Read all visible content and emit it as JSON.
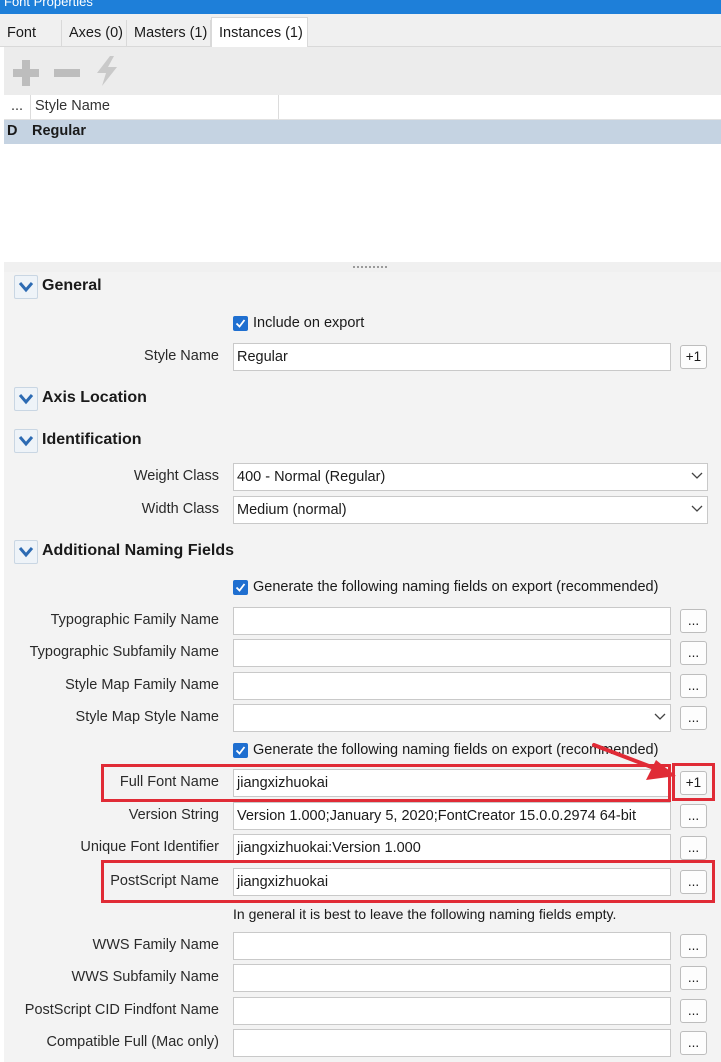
{
  "window": {
    "title": "Font Properties"
  },
  "tabs": [
    {
      "label": "Font"
    },
    {
      "label": "Axes (0)"
    },
    {
      "label": "Masters (1)"
    },
    {
      "label": "Instances (1)",
      "active": true
    }
  ],
  "toolbar": {
    "icons": [
      "add-icon",
      "remove-icon",
      "lightning-icon"
    ]
  },
  "instance_list": {
    "headers": [
      "...",
      "Style Name"
    ],
    "rows": [
      {
        "flag": "D",
        "style_name": "Regular",
        "selected": true
      }
    ]
  },
  "sections": {
    "general": {
      "title": "General",
      "include_on_export": {
        "label": "Include on export",
        "checked": true
      },
      "style_name": {
        "label": "Style Name",
        "value": "Regular",
        "button": "+1"
      }
    },
    "axis_location": {
      "title": "Axis Location"
    },
    "identification": {
      "title": "Identification",
      "weight_class": {
        "label": "Weight Class",
        "value": "400 - Normal (Regular)"
      },
      "width_class": {
        "label": "Width Class",
        "value": "Medium (normal)"
      }
    },
    "naming": {
      "title": "Additional Naming Fields",
      "generate1": {
        "label": "Generate the following naming fields on export (recommended)",
        "checked": true
      },
      "typographic_family": {
        "label": "Typographic Family Name",
        "value": "",
        "button": "..."
      },
      "typographic_subfamily": {
        "label": "Typographic Subfamily Name",
        "value": "",
        "button": "..."
      },
      "style_map_family": {
        "label": "Style Map Family Name",
        "value": "",
        "button": "..."
      },
      "style_map_style": {
        "label": "Style Map Style Name",
        "value": "",
        "button": "..."
      },
      "generate2": {
        "label": "Generate the following naming fields on export (recommended)",
        "checked": true
      },
      "full_font_name": {
        "label": "Full Font Name",
        "value": "jiangxizhuokai",
        "button": "+1"
      },
      "version_string": {
        "label": "Version String",
        "value": "Version 1.000;January 5, 2020;FontCreator 15.0.0.2974 64-bit",
        "button": "..."
      },
      "unique_id": {
        "label": "Unique Font Identifier",
        "value": "jiangxizhuokai:Version 1.000",
        "button": "..."
      },
      "postscript_name": {
        "label": "PostScript Name",
        "value": "jiangxizhuokai",
        "button": "..."
      },
      "note": "In general it is best to leave the following naming fields empty.",
      "wws_family": {
        "label": "WWS Family Name",
        "value": "",
        "button": "..."
      },
      "wws_subfamily": {
        "label": "WWS Subfamily Name",
        "value": "",
        "button": "..."
      },
      "ps_cid_findfont": {
        "label": "PostScript CID Findfont Name",
        "value": "",
        "button": "..."
      },
      "compatible_full": {
        "label": "Compatible Full (Mac only)",
        "value": "",
        "button": "..."
      }
    }
  },
  "colors": {
    "accent": "#1e7fd9",
    "selection": "#c5d3e2",
    "highlight": "#e02b36",
    "checkbox": "#1f6fd0"
  }
}
